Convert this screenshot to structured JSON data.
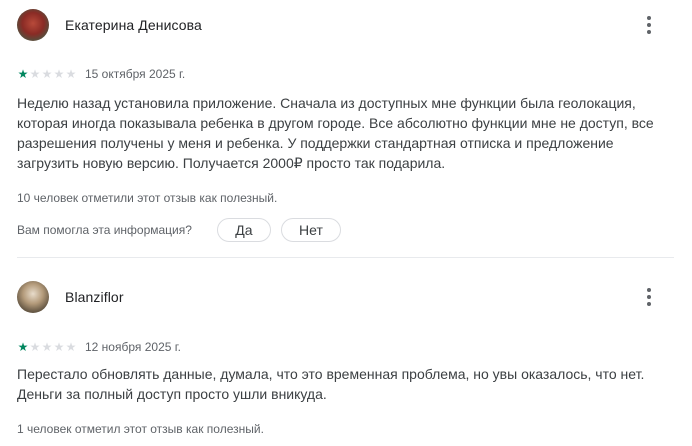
{
  "reviews": [
    {
      "author": "Екатерина Денисова",
      "rating": 1,
      "date": "15 октября 2025 г.",
      "text": "Неделю назад установила приложение. Сначала из доступных мне функции была геолокация, которая иногда показывала ребенка в другом городе. Все абсолютно функции мне не доступ, все разрешения получены у меня и ребенка. У поддержки стандартная отписка и предложение загрузить новую версию. Получается 2000₽ просто так подарила.",
      "helpful": "10 человек отметили этот отзыв как полезный.",
      "feedback_question": "Вам помогла эта информация?",
      "yes_label": "Да",
      "no_label": "Нет"
    },
    {
      "author": "Blanziflor",
      "rating": 1,
      "date": "12 ноября 2025 г.",
      "text": "Перестало обновлять данные, думала, что это временная проблема, но увы оказалось, что нет. Деньги за полный доступ просто ушли вникуда.",
      "helpful": "1 человек отметил этот отзыв как полезный."
    }
  ],
  "icons": {
    "menu": "more-vert-icon",
    "star": "star-icon"
  },
  "colors": {
    "star_filled": "#01875f",
    "star_empty": "#dadce0"
  }
}
